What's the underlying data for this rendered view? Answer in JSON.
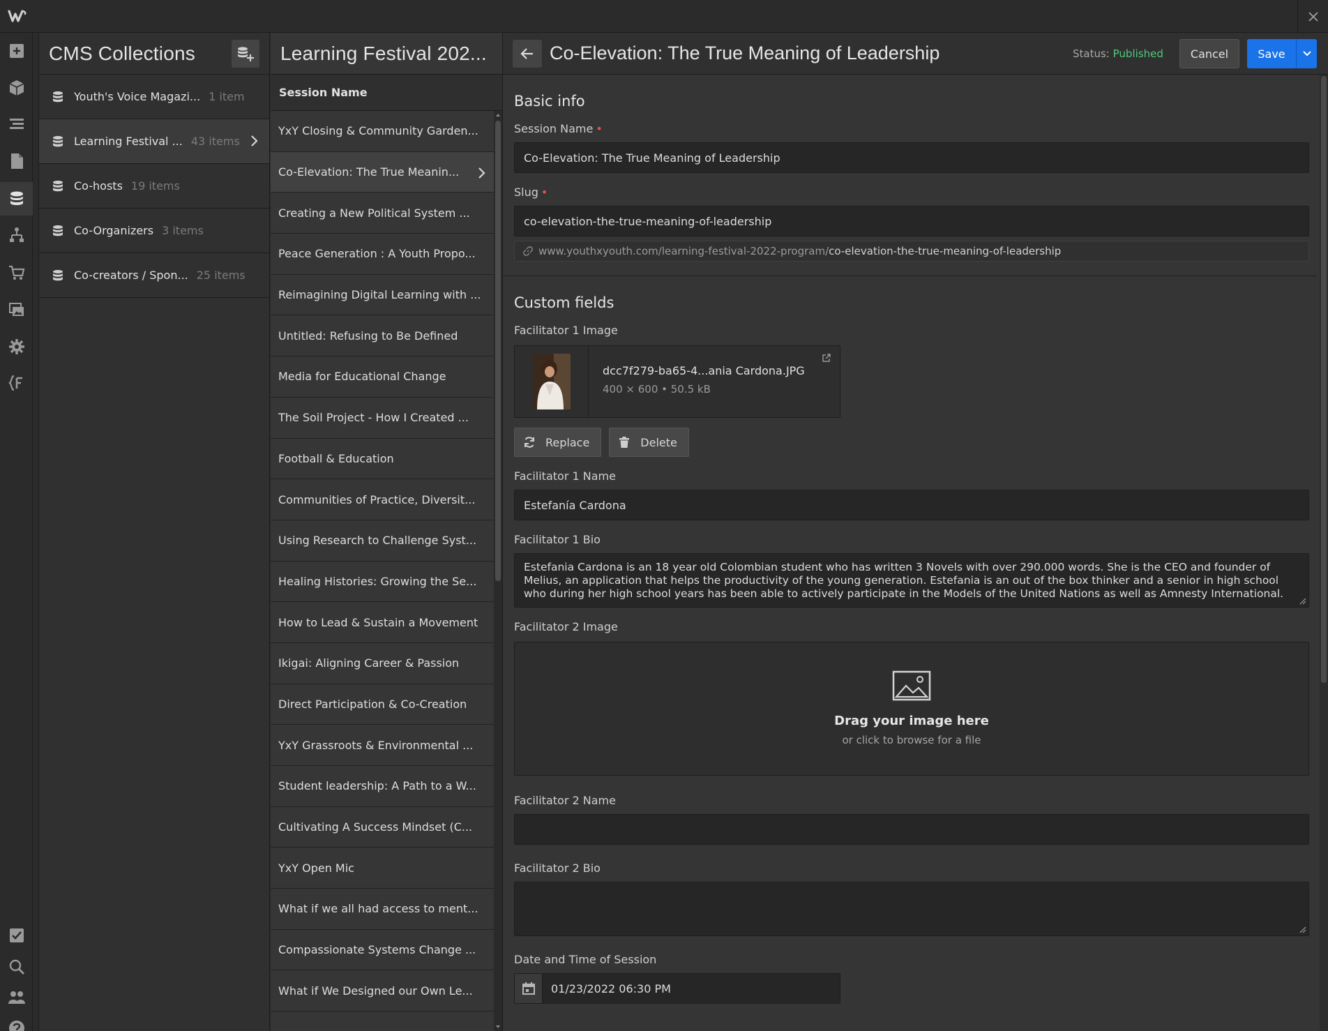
{
  "app": {
    "logo_icon": "webflow-logo-icon",
    "close_icon": "close-icon"
  },
  "rail": {
    "top_icons": [
      "add-icon",
      "box-icon",
      "navigator-icon",
      "pages-icon",
      "cms-icon",
      "logic-icon",
      "ecommerce-icon",
      "assets-icon",
      "settings-icon",
      "custom-code-icon"
    ],
    "bottom_icons": [
      "audit-icon",
      "search-icon",
      "users-icon",
      "help-icon"
    ]
  },
  "collections": {
    "title": "CMS Collections",
    "items": [
      {
        "name": "Youth's Voice Magazi...",
        "count": "1 item"
      },
      {
        "name": "Learning Festival ...",
        "count": "43 items"
      },
      {
        "name": "Co-hosts",
        "count": "19 items"
      },
      {
        "name": "Co-Organizers",
        "count": "3 items"
      },
      {
        "name": "Co-creators / Spon...",
        "count": "25 items"
      }
    ]
  },
  "list": {
    "title": "Learning Festival 202...",
    "column": "Session Name",
    "rows": [
      "YxY Closing & Community Garden...",
      "Co-Elevation: The True Meanin...",
      "Creating a New Political System ...",
      "Peace Generation : A Youth Propo...",
      "Reimagining Digital Learning with ...",
      "Untitled: Refusing to Be Defined",
      "Media for Educational Change",
      "The Soil Project - How I Created ...",
      "Football & Education",
      "Communities of Practice, Diversit...",
      "Using Research to Challenge Syst...",
      "Healing Histories: Growing the Se...",
      "How to Lead & Sustain a Movement",
      "Ikigai: Aligning Career & Passion",
      "Direct Participation & Co-Creation",
      "YxY Grassroots & Environmental ...",
      "Student leadership: A Path to a W...",
      "Cultivating A Success Mindset (C...",
      "YxY Open Mic",
      "What if we all had access to ment...",
      "Compassionate Systems Change ...",
      "What if We Designed our Own Le..."
    ]
  },
  "editor": {
    "title": "Co-Elevation: The True Meaning of Leadership",
    "status_label": "Status:",
    "status_value": "Published",
    "cancel": "Cancel",
    "save": "Save",
    "basic_info": "Basic info",
    "session_name_label": "Session Name",
    "session_name_value": "Co-Elevation: The True Meaning of Leadership",
    "slug_label": "Slug",
    "slug_value": "co-elevation-the-true-meaning-of-leadership",
    "url_base": "www.youthxyouth.com/learning-festival-2022-program/",
    "url_slug": "co-elevation-the-true-meaning-of-leadership",
    "custom_fields": "Custom fields",
    "f1_image_label": "Facilitator 1 Image",
    "f1_image_name": "dcc7f279-ba65-4...ania Cardona.JPG",
    "f1_image_meta": "400 × 600 • 50.5 kB",
    "replace": "Replace",
    "delete": "Delete",
    "f1_name_label": "Facilitator 1 Name",
    "f1_name_value": "Estefanía Cardona",
    "f1_bio_label": "Facilitator 1 Bio",
    "f1_bio_value": "Estefania Cardona is an 18 year old Colombian student who has written 3 Novels with over 290.000 words. She is the CEO and founder of Melius, an application that helps the productivity of the young generation. Estefania is an out of the box thinker and a senior in high school who during her high school years has been able to actively participate in the Models of the United Nations as well as Amnesty International.",
    "f2_image_label": "Facilitator 2 Image",
    "dz_title": "Drag your image here",
    "dz_sub": "or click to browse for a file",
    "f2_name_label": "Facilitator 2 Name",
    "f2_name_value": "",
    "f2_bio_label": "Facilitator 2 Bio",
    "f2_bio_value": "",
    "date_label": "Date and Time of Session",
    "date_value": "01/23/2022 06:30 PM"
  },
  "colors": {
    "accent": "#1a73e8",
    "published": "#4fc97a",
    "required": "#e4514f"
  }
}
